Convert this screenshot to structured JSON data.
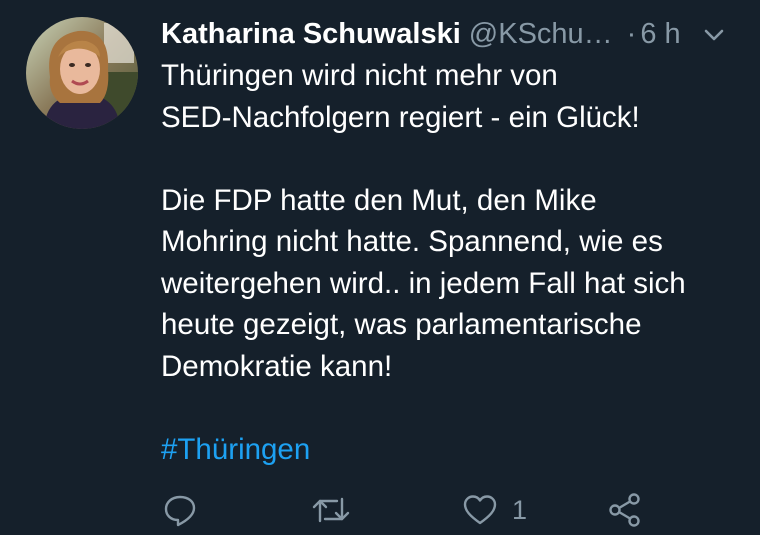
{
  "tweet": {
    "author_name": "Katharina Schuwalski",
    "author_handle": "@KSchu…",
    "separator": "·",
    "time": "6 h",
    "paragraph1_line1": "Thüringen wird nicht mehr von",
    "paragraph1_line2": "SED-Nachfolgern regiert - ein Glück!",
    "paragraph2_line1": "Die FDP hatte den Mut, den Mike",
    "paragraph2_line2": "Mohring nicht hatte. Spannend, wie es",
    "paragraph2_line3": "weitergehen wird.. in jedem Fall hat sich",
    "paragraph2_line4": "heute gezeigt, was parlamentarische",
    "paragraph2_line5": "Demokratie kann!",
    "hashtag": "#Thüringen"
  },
  "actions": {
    "reply_icon": "reply-icon",
    "retweet_icon": "retweet-icon",
    "like_icon": "heart-icon",
    "like_count": "1",
    "share_icon": "share-icon"
  },
  "colors": {
    "background": "#15202b",
    "text": "#ffffff",
    "secondary": "#8899a6",
    "link": "#1da1f2"
  }
}
